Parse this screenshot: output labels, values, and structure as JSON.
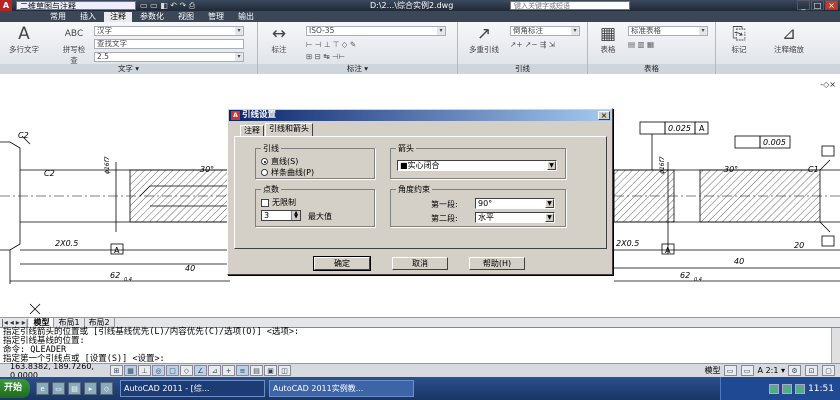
{
  "window": {
    "workspace": "二维草图与注释",
    "document_title": "D:\\2...\\综合实例2.dwg",
    "keyword_placeholder": "键入关键字或短语",
    "min": "_",
    "max": "□",
    "close": "×"
  },
  "ribbon_tabs": [
    "常用",
    "插入",
    "注释",
    "参数化",
    "视图",
    "管理",
    "输出"
  ],
  "ribbon": {
    "text_panel": {
      "title": "文字 ▾",
      "multiline": "多行文字",
      "spell": "拼写检查",
      "style": "汉字",
      "find_placeholder": "查找文字",
      "height": "2.5"
    },
    "dim_panel": {
      "title": "标注 ▾",
      "dim": "标注",
      "style": "ISO-35"
    },
    "leader_panel": {
      "title": "引线",
      "multileader": "多重引线",
      "style": "倒角标注"
    },
    "table_panel": {
      "title": "表格",
      "table": "表格",
      "style": "标准表格"
    },
    "mark_panel": {
      "mark": "标记",
      "scale": "注释缩放"
    }
  },
  "drawing": {
    "viewport_label": "-◇×",
    "dims": [
      "C2",
      "C2",
      "2X0.5",
      "A",
      "40",
      "62",
      "0.4",
      "C1",
      "30°",
      "30°",
      "ϕ16f7",
      "ϕ16f7",
      "A",
      "2X0.5",
      "20",
      "40",
      "62",
      "0.4",
      "0.025",
      "A",
      "0.005"
    ]
  },
  "dialog": {
    "title": "引线设置",
    "close": "×",
    "tabs": [
      "注释",
      "引线和箭头"
    ],
    "leader_group": "引线",
    "straight": "直线(S)",
    "spline": "样条曲线(P)",
    "points_group": "点数",
    "unlimited": "无限制",
    "points_value": "3",
    "max_label": "最大值",
    "arrow_group": "箭头",
    "arrow_value": "实心闭合",
    "angle_group": "角度约束",
    "first_seg": "第一段:",
    "first_value": "90°",
    "second_seg": "第二段:",
    "second_value": "水平",
    "ok": "确定",
    "cancel": "取消",
    "help": "帮助(H)"
  },
  "layout_tabs": {
    "nav": [
      "|◂",
      "◂",
      "▸",
      "▸|"
    ],
    "tabs": [
      "模型",
      "布局1",
      "布局2"
    ]
  },
  "command_lines": [
    "指定引线箭头的位置或 [引线基线优先(L)/内容优先(C)/选项(O)] <选项>:",
    "指定引线基线的位置:",
    "命令: QLEADER",
    "指定第一个引线点或 [设置(S)] <设置>:"
  ],
  "status": {
    "coords": "163.8382, 189.7260, 0.0000",
    "model": "模型",
    "scale": "A 2:1 ▾"
  },
  "taskbar": {
    "start": "开始",
    "tasks": [
      "AutoCAD 2011 - [综...",
      "AutoCAD 2011实例教..."
    ],
    "clock": "11:51"
  }
}
